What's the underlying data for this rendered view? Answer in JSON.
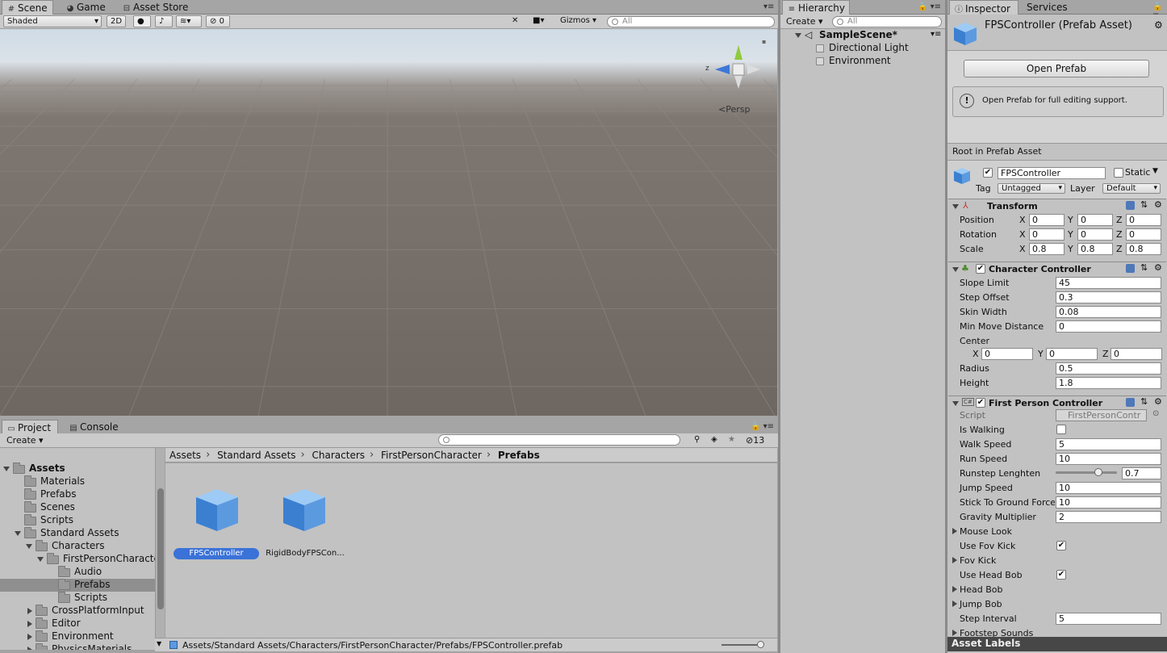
{
  "scene_tabs": [
    {
      "icon": "grid-icon",
      "label": "Scene"
    },
    {
      "icon": "pacman-icon",
      "label": "Game"
    },
    {
      "icon": "store-icon",
      "label": "Asset Store"
    }
  ],
  "scene_toolbar": {
    "shading": "Shaded",
    "mode_2d": "2D",
    "hidden_count": "0",
    "gizmos": "Gizmos",
    "search_placeholder": "All"
  },
  "scene_view": {
    "projection": "Persp",
    "axis_label": "z"
  },
  "hierarchy": {
    "tab": "Hierarchy",
    "create": "Create",
    "search_placeholder": "All",
    "scene_name": "SampleScene*",
    "items": [
      "Directional Light",
      "Environment"
    ]
  },
  "inspector": {
    "tabs": [
      "Inspector",
      "Services"
    ],
    "title": "FPSController (Prefab Asset)",
    "open_prefab": "Open Prefab",
    "info_text": "Open Prefab for full editing support.",
    "root_label": "Root in Prefab Asset",
    "object_name": "FPSController",
    "static_label": "Static",
    "tag_label": "Tag",
    "tag_value": "Untagged",
    "layer_label": "Layer",
    "layer_value": "Default",
    "transform": {
      "title": "Transform",
      "rows": [
        {
          "label": "Position",
          "x": "0",
          "y": "0",
          "z": "0"
        },
        {
          "label": "Rotation",
          "x": "0",
          "y": "0",
          "z": "0"
        },
        {
          "label": "Scale",
          "x": "0.8",
          "y": "0.8",
          "z": "0.8"
        }
      ]
    },
    "character_controller": {
      "title": "Character Controller",
      "slope_limit": {
        "label": "Slope Limit",
        "value": "45"
      },
      "step_offset": {
        "label": "Step Offset",
        "value": "0.3"
      },
      "skin_width": {
        "label": "Skin Width",
        "value": "0.08"
      },
      "min_move": {
        "label": "Min Move Distance",
        "value": "0"
      },
      "center_label": "Center",
      "center": {
        "x": "0",
        "y": "0",
        "z": "0"
      },
      "radius": {
        "label": "Radius",
        "value": "0.5"
      },
      "height": {
        "label": "Height",
        "value": "1.8"
      }
    },
    "fpc": {
      "title": "First Person Controller",
      "script_label": "Script",
      "script_value": "FirstPersonContr",
      "is_walking": "Is Walking",
      "walk_speed": {
        "label": "Walk Speed",
        "value": "5"
      },
      "run_speed": {
        "label": "Run Speed",
        "value": "10"
      },
      "runstep": {
        "label": "Runstep Lenghten",
        "value": "0.7",
        "slider_fraction": 0.7
      },
      "jump_speed": {
        "label": "Jump Speed",
        "value": "10"
      },
      "stick": {
        "label": "Stick To Ground Force",
        "value": "10"
      },
      "gravity": {
        "label": "Gravity Multiplier",
        "value": "2"
      },
      "mouse_look": "Mouse Look",
      "use_fov_kick": "Use Fov Kick",
      "fov_kick": "Fov Kick",
      "use_head_bob": "Use Head Bob",
      "head_bob": "Head Bob",
      "jump_bob": "Jump Bob",
      "step_interval": {
        "label": "Step Interval",
        "value": "5"
      },
      "footstep": "Footstep Sounds"
    },
    "asset_labels": "Asset Labels"
  },
  "project": {
    "tabs": [
      "Project",
      "Console"
    ],
    "create": "Create",
    "hidden_count": "13",
    "tree": [
      {
        "label": "Assets",
        "depth": 0,
        "expanded": true,
        "bold": true
      },
      {
        "label": "Materials",
        "depth": 1
      },
      {
        "label": "Prefabs",
        "depth": 1
      },
      {
        "label": "Scenes",
        "depth": 1
      },
      {
        "label": "Scripts",
        "depth": 1
      },
      {
        "label": "Standard Assets",
        "depth": 1,
        "expanded": true
      },
      {
        "label": "Characters",
        "depth": 2,
        "expanded": true
      },
      {
        "label": "FirstPersonCharacter",
        "depth": 3,
        "expanded": true
      },
      {
        "label": "Audio",
        "depth": 4
      },
      {
        "label": "Prefabs",
        "depth": 4,
        "selected": true
      },
      {
        "label": "Scripts",
        "depth": 4
      },
      {
        "label": "CrossPlatformInput",
        "depth": 2,
        "collapsed": true
      },
      {
        "label": "Editor",
        "depth": 2,
        "collapsed": true
      },
      {
        "label": "Environment",
        "depth": 2,
        "collapsed": true
      },
      {
        "label": "PhysicsMaterials",
        "depth": 2,
        "collapsed": true
      }
    ],
    "breadcrumb": [
      "Assets",
      "Standard Assets",
      "Characters",
      "FirstPersonCharacter",
      "Prefabs"
    ],
    "assets": [
      {
        "label": "FPSController",
        "selected": true
      },
      {
        "label": "RigidBodyFPSCon..."
      }
    ],
    "status_path": "Assets/Standard Assets/Characters/FirstPersonCharacter/Prefabs/FPSController.prefab"
  }
}
